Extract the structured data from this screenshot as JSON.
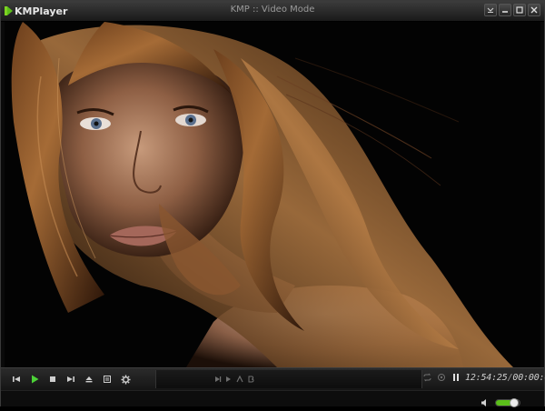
{
  "app": {
    "brand": "KMPlayer",
    "title": "KMP :: Video Mode"
  },
  "titlebar": {
    "buttons": [
      "settings-icon",
      "minimize-icon",
      "maximize-icon",
      "close-icon"
    ]
  },
  "controls": {
    "left": [
      "previous-icon",
      "play-icon",
      "stop-icon",
      "next-icon",
      "eject-icon",
      "playlist-icon",
      "settings-icon"
    ],
    "seek_icons": [
      "frame-back-icon",
      "frame-forward-icon",
      "a-marker-icon",
      "b-marker-icon"
    ],
    "time_current": "12:54:25",
    "time_separator": "/",
    "time_total": "00:00:00"
  },
  "volume": {
    "level": 0.7
  },
  "colors": {
    "accent": "#5bbf1a",
    "play_green": "#4cd137",
    "chrome": "#1a1a1a"
  }
}
